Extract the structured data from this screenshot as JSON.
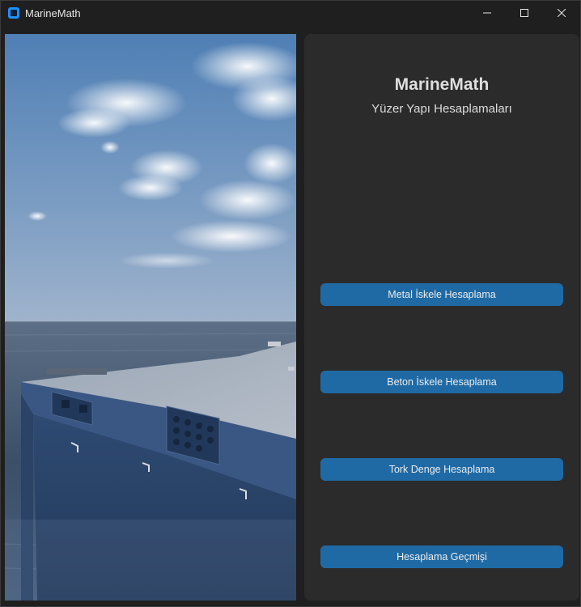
{
  "window": {
    "title": "MarineMath",
    "controls": {
      "minimize_icon": "minimize-icon",
      "maximize_icon": "maximize-icon",
      "close_icon": "close-icon"
    }
  },
  "hero_image": {
    "subject": "floating concrete pontoon on the sea under a cloudy blue sky"
  },
  "panel": {
    "title": "MarineMath",
    "subtitle": "Yüzer Yapı Hesaplamaları",
    "buttons": [
      {
        "label": "Metal İskele Hesaplama"
      },
      {
        "label": "Beton İskele Hesaplama"
      },
      {
        "label": "Tork Denge Hesaplama"
      },
      {
        "label": "Hesaplama Geçmişi"
      }
    ]
  },
  "colors": {
    "window_bg": "#1f1f1f",
    "panel_bg": "#2b2b2b",
    "button_bg": "#1f6aa5",
    "app_icon": "#1e90ff"
  }
}
